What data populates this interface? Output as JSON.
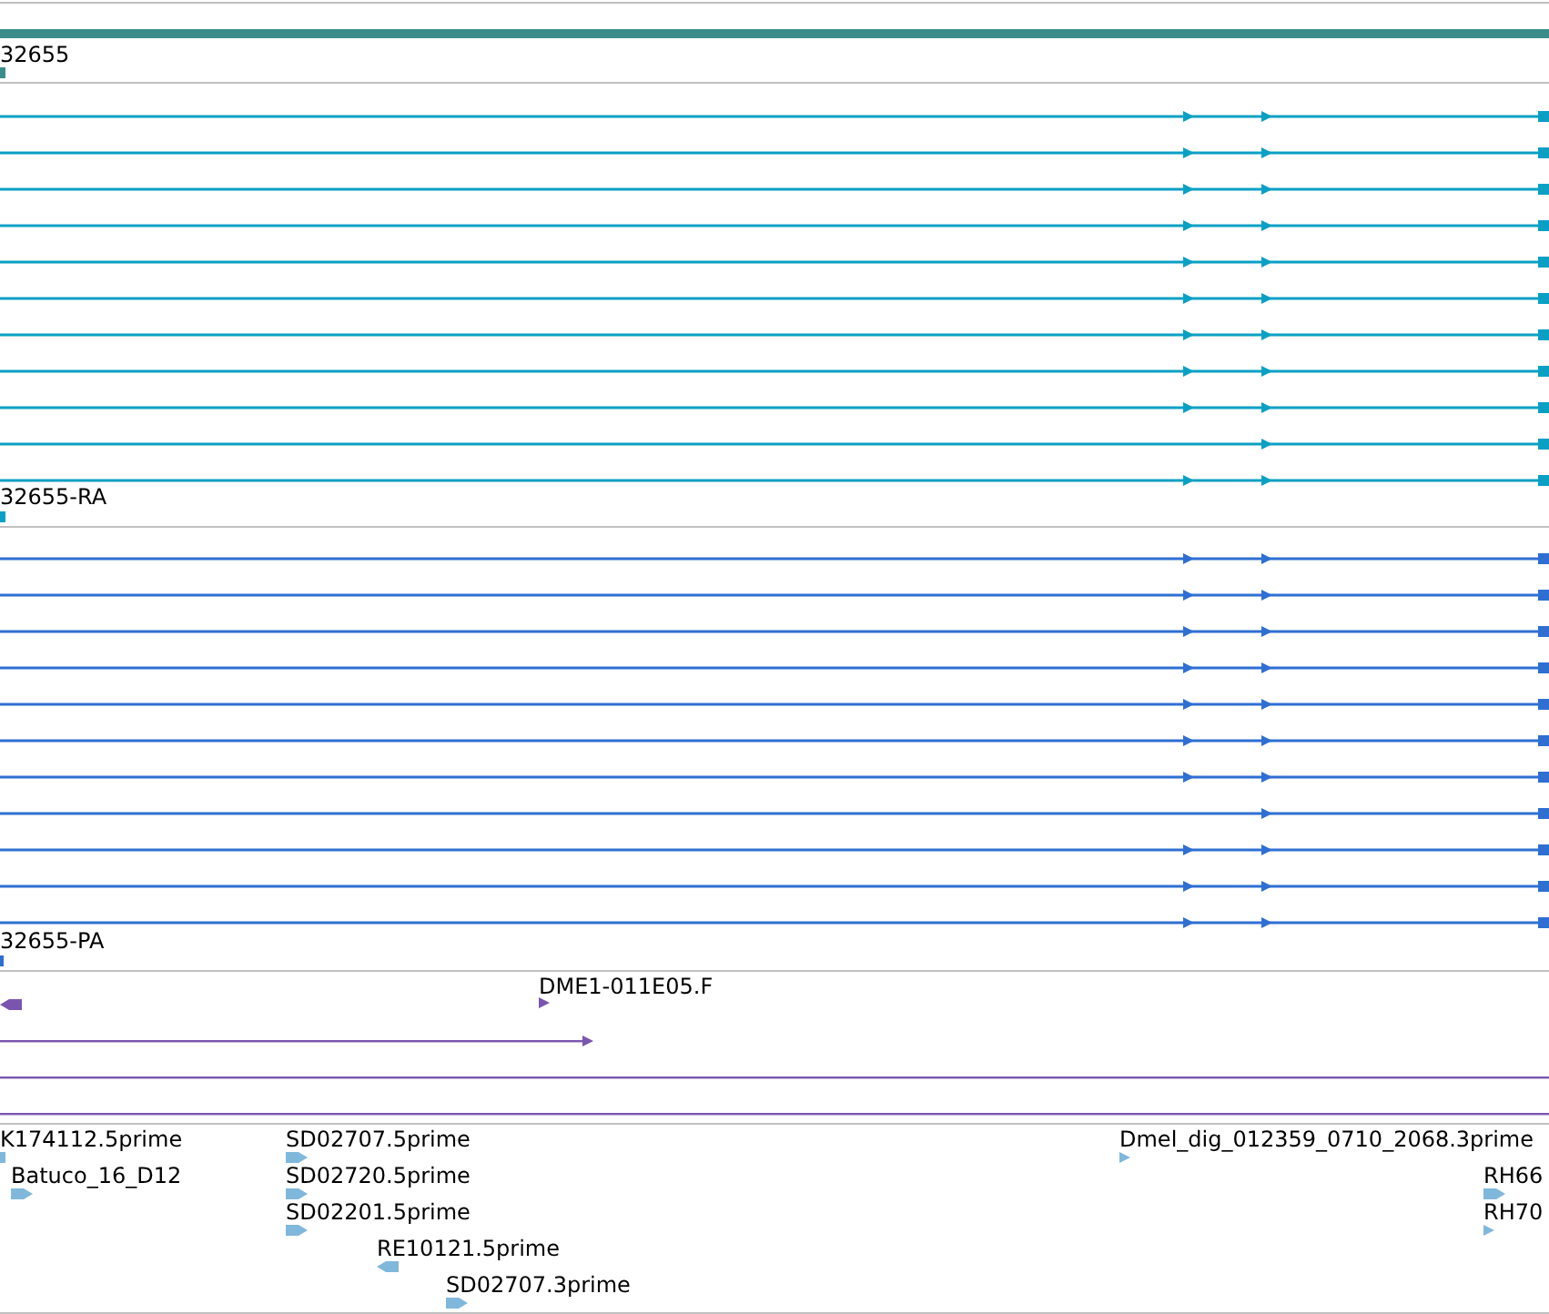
{
  "tracks": [
    {
      "kind": "gene",
      "color": "#3d8c8c",
      "label": "32655"
    },
    {
      "kind": "transcripts",
      "color": "#0aa0c4",
      "label": "32655-RA",
      "rows": [
        {
          "kind": "two-arrows"
        },
        {
          "kind": "two-arrows"
        },
        {
          "kind": "two-arrows"
        },
        {
          "kind": "two-arrows"
        },
        {
          "kind": "two-arrows"
        },
        {
          "kind": "two-arrows"
        },
        {
          "kind": "two-arrows"
        },
        {
          "kind": "two-arrows"
        },
        {
          "kind": "two-arrows"
        },
        {
          "kind": "one-arrow"
        },
        {
          "kind": "two-arrows"
        }
      ]
    },
    {
      "kind": "transcripts",
      "color": "#2f6fd2",
      "label": "32655-PA",
      "rows": [
        {
          "kind": "two-arrows"
        },
        {
          "kind": "two-arrows"
        },
        {
          "kind": "two-arrows"
        },
        {
          "kind": "two-arrows"
        },
        {
          "kind": "two-arrows"
        },
        {
          "kind": "two-arrows"
        },
        {
          "kind": "two-arrows"
        },
        {
          "kind": "one-arrow"
        },
        {
          "kind": "two-arrows"
        },
        {
          "kind": "two-arrows"
        },
        {
          "kind": "two-arrows"
        }
      ]
    },
    {
      "kind": "alignments",
      "color": "#7a55b0",
      "features": [
        {
          "kind": "reverse"
        },
        {
          "kind": "forward",
          "label": "DME1-011E05.F"
        },
        {
          "kind": "long"
        },
        {
          "kind": "full"
        },
        {
          "kind": "full"
        }
      ]
    },
    {
      "kind": "ests",
      "color": "#80b8dc",
      "features": [
        {
          "kind": "stub",
          "label": "K174112.5prime"
        },
        {
          "kind": "forward",
          "label": "Batuco_16_D12"
        },
        {
          "kind": "forward",
          "label": "SD02707.5prime"
        },
        {
          "kind": "forward",
          "label": "SD02720.5prime"
        },
        {
          "kind": "forward",
          "label": "SD02201.5prime"
        },
        {
          "kind": "reverse",
          "label": "RE10121.5prime"
        },
        {
          "kind": "forward",
          "label": "SD02707.3prime"
        },
        {
          "kind": "small",
          "label": "Dmel_dig_012359_0710_2068.3prime"
        },
        {
          "kind": "forward",
          "label": "RH66"
        },
        {
          "kind": "small",
          "label": "RH70"
        }
      ]
    }
  ]
}
